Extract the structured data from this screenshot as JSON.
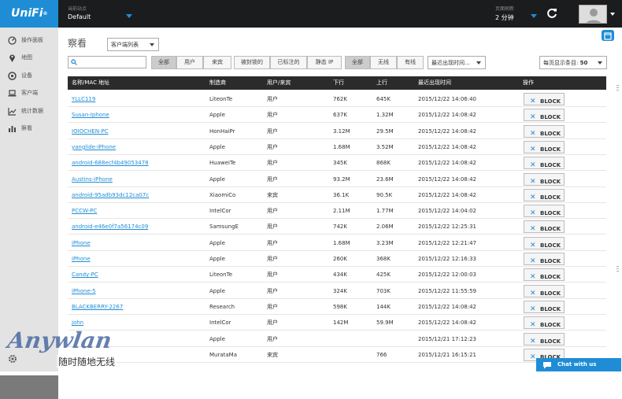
{
  "header": {
    "logo": "UniFi",
    "logo_mark": "®",
    "site_label": "当前站点",
    "site_value": "Default",
    "refresh_label": "页面刷新",
    "refresh_value": "2 分钟"
  },
  "sidebar": {
    "items": [
      {
        "label": "操作面板",
        "icon": "dashboard-icon"
      },
      {
        "label": "地图",
        "icon": "map-pin-icon"
      },
      {
        "label": "设备",
        "icon": "device-icon"
      },
      {
        "label": "客户端",
        "icon": "laptop-icon"
      },
      {
        "label": "统计数据",
        "icon": "stats-icon"
      },
      {
        "label": "察看",
        "icon": "insights-icon"
      }
    ]
  },
  "watermark": {
    "en": "Anywlan",
    "cn": "随时随地无线"
  },
  "main": {
    "title": "察看",
    "view_select": "客户端列表",
    "filters": {
      "group1": [
        "全部",
        "用户",
        "来宾"
      ],
      "group2": [
        "被封锁的",
        "已标注的",
        "静态 IP"
      ],
      "group3": [
        "全部",
        "无线",
        "有线"
      ]
    },
    "sort_select": "最近出现时间...",
    "page_size_label": "每页显示条目:",
    "page_size_value": "50"
  },
  "table": {
    "columns": [
      "名称/MAC 地址",
      "制造商",
      "用户/来宾",
      "下行",
      "上行",
      "最近出现时间",
      "操作"
    ],
    "block_label": "BLOCK",
    "rows": [
      {
        "name": "YLLC119",
        "vendor": "LiteonTe",
        "type": "用户",
        "down": "762K",
        "up": "645K",
        "time": "2015/12/22 14:06:40"
      },
      {
        "name": "Susan-Iphone",
        "vendor": "Apple",
        "type": "用户",
        "down": "637K",
        "up": "1.32M",
        "time": "2015/12/22 14:08:42"
      },
      {
        "name": "IOIOCHEN-PC",
        "vendor": "HonHaiPr",
        "type": "用户",
        "down": "3.12M",
        "up": "29.5M",
        "time": "2015/12/22 14:08:42"
      },
      {
        "name": "yanglide-iPhone",
        "vendor": "Apple",
        "type": "用户",
        "down": "1.68M",
        "up": "3.52M",
        "time": "2015/12/22 14:08:42"
      },
      {
        "name": "android-688ecf4b49053478",
        "vendor": "HuaweiTe",
        "type": "用户",
        "down": "345K",
        "up": "868K",
        "time": "2015/12/22 14:08:42"
      },
      {
        "name": "Austins-iPhone",
        "vendor": "Apple",
        "type": "用户",
        "down": "93.2M",
        "up": "23.6M",
        "time": "2015/12/22 14:08:42"
      },
      {
        "name": "android-95adb93dc12ca07c",
        "vendor": "XiaomiCo",
        "type": "来宾",
        "down": "36.1K",
        "up": "90.5K",
        "time": "2015/12/22 14:08:42"
      },
      {
        "name": "PCCW-PC",
        "vendor": "IntelCor",
        "type": "用户",
        "down": "2.11M",
        "up": "1.77M",
        "time": "2015/12/22 14:04:02"
      },
      {
        "name": "android-e46e0f7a56174c09",
        "vendor": "SamsungE",
        "type": "用户",
        "down": "742K",
        "up": "2.06M",
        "time": "2015/12/22 12:25:31"
      },
      {
        "name": "iPhone",
        "vendor": "Apple",
        "type": "用户",
        "down": "1.68M",
        "up": "3.23M",
        "time": "2015/12/22 12:21:47"
      },
      {
        "name": "iPhone",
        "vendor": "Apple",
        "type": "用户",
        "down": "260K",
        "up": "368K",
        "time": "2015/12/22 12:16:33"
      },
      {
        "name": "Candy-PC",
        "vendor": "LiteonTe",
        "type": "用户",
        "down": "434K",
        "up": "425K",
        "time": "2015/12/22 12:00:03"
      },
      {
        "name": "iPhone-5",
        "vendor": "Apple",
        "type": "用户",
        "down": "324K",
        "up": "703K",
        "time": "2015/12/22 11:55:59"
      },
      {
        "name": "BLACKBERRY-2267",
        "vendor": "Research",
        "type": "用户",
        "down": "598K",
        "up": "144K",
        "time": "2015/12/22 14:08:42"
      },
      {
        "name": "john",
        "vendor": "IntelCor",
        "type": "用户",
        "down": "142M",
        "up": "59.9M",
        "time": "2015/12/22 14:08:42"
      },
      {
        "name": "",
        "vendor": "Apple",
        "type": "用户",
        "down": "",
        "up": "",
        "time": "2015/12/21 17:12:23"
      },
      {
        "name": "",
        "vendor": "MurataMa",
        "type": "来宾",
        "down": "",
        "up": "766",
        "time": "2015/12/21 16:15:21"
      }
    ]
  },
  "chat": {
    "label": "Chat with us"
  }
}
